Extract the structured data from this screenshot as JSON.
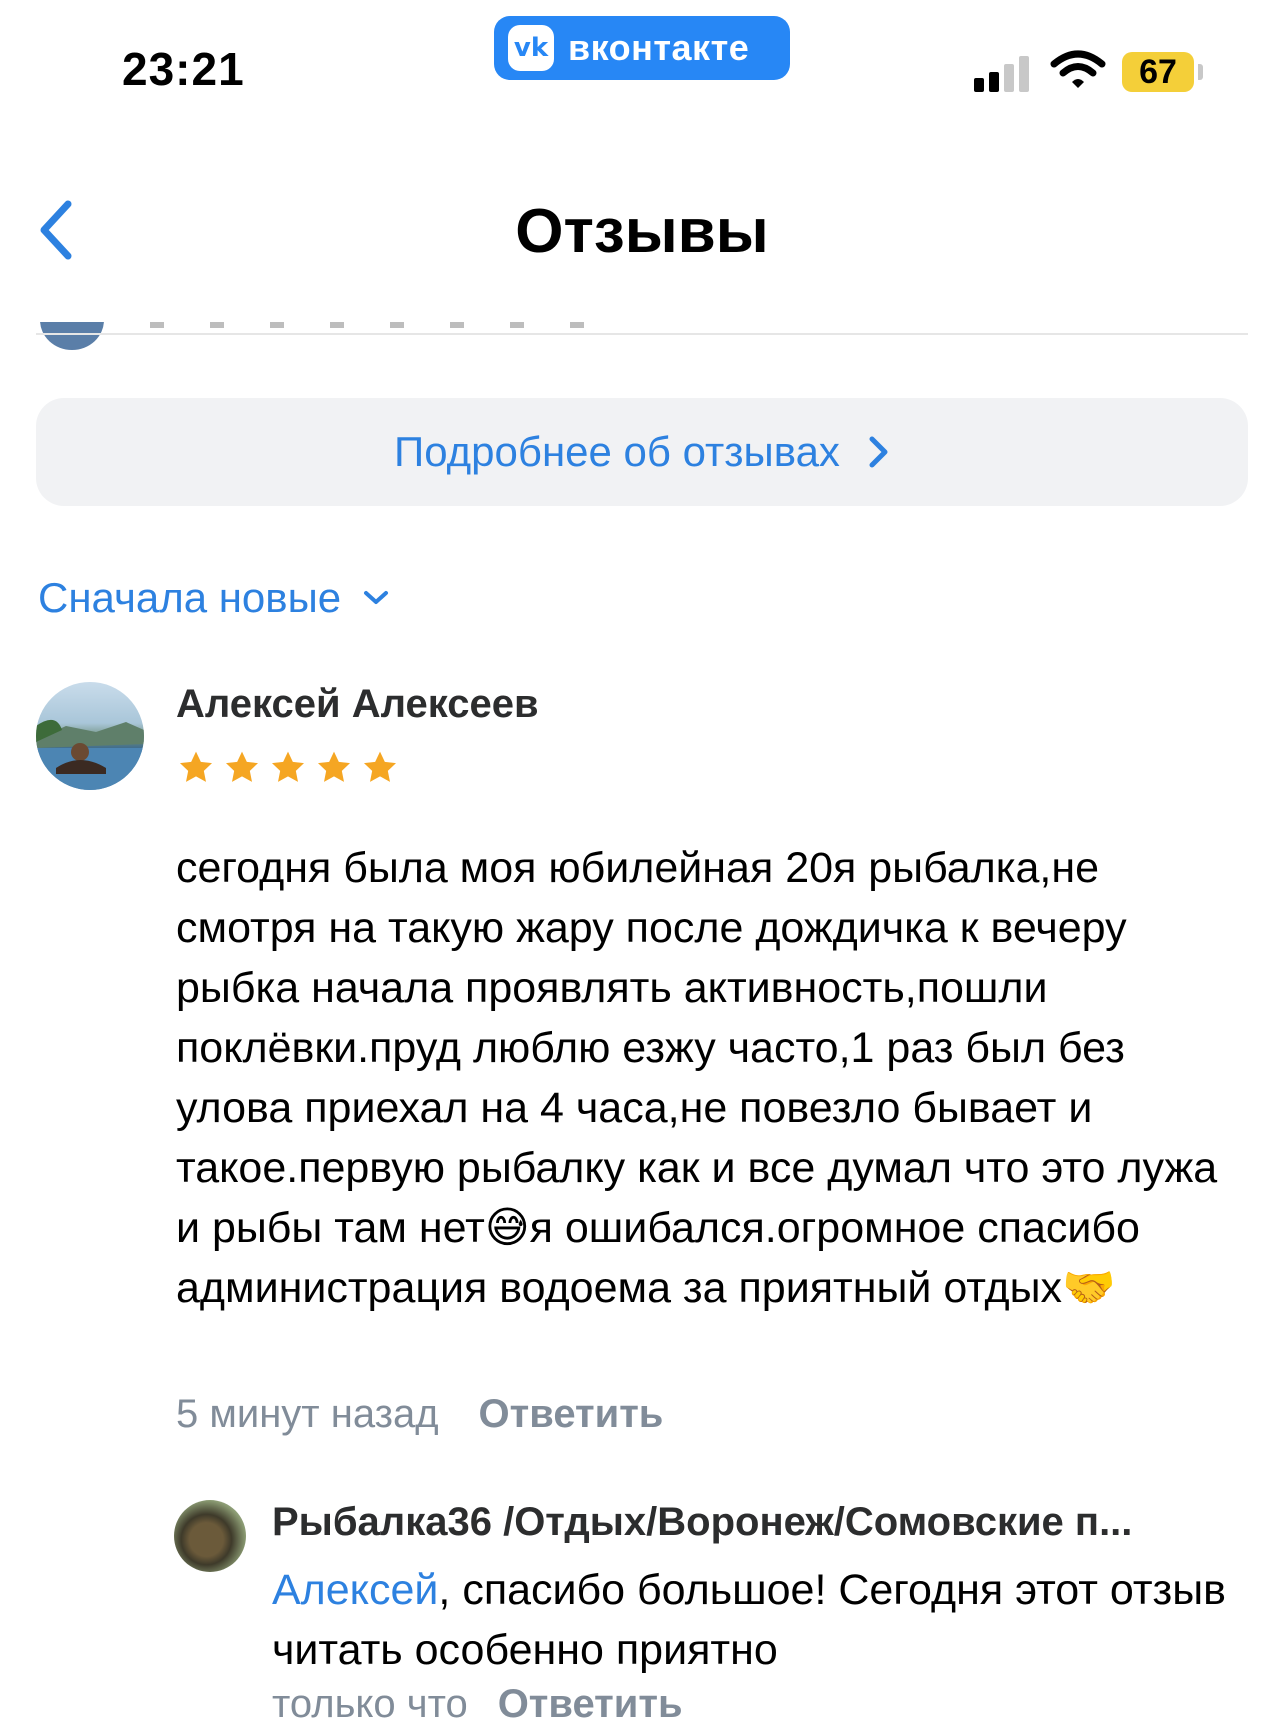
{
  "status_bar": {
    "time": "23:21",
    "app_badge": "вконтакте",
    "app_logo": "vk",
    "battery": "67",
    "battery_color": "#f4cf39"
  },
  "header": {
    "title": "Отзывы"
  },
  "more_button": {
    "label": "Подробнее об отзывах"
  },
  "sort": {
    "label": "Сначала новые"
  },
  "review": {
    "author": "Алексей Алексеев",
    "rating": 5,
    "rating_max": 5,
    "text": "сегодня была моя юбилейная 20я рыбалка,не смотря на такую жару после дождичка к вечеру рыбка начала проявлять активность,пошли поклёвки.пруд люблю езжу часто,1 раз был без улова приехал на 4 часа,не повезло бывает и такое.первую рыбалку как и все думал что это лужа и рыбы там нет😅я ошибался.огромное спасибо администрация водоема за приятный отдых🤝",
    "time": "5 минут назад",
    "reply_label": "Ответить"
  },
  "owner_reply": {
    "author": "Рыбалка36 /Отдых/Воронеж/Сомовские п...",
    "mention": "Алексей",
    "text": ", спасибо большое! Сегодня этот отзыв читать особенно приятно",
    "time": "только что",
    "reply_label": "Ответить"
  },
  "colors": {
    "accent": "#2d81e0",
    "vk_blue": "#2787f5",
    "star": "#f5a623",
    "secondary_text": "#818c99"
  }
}
